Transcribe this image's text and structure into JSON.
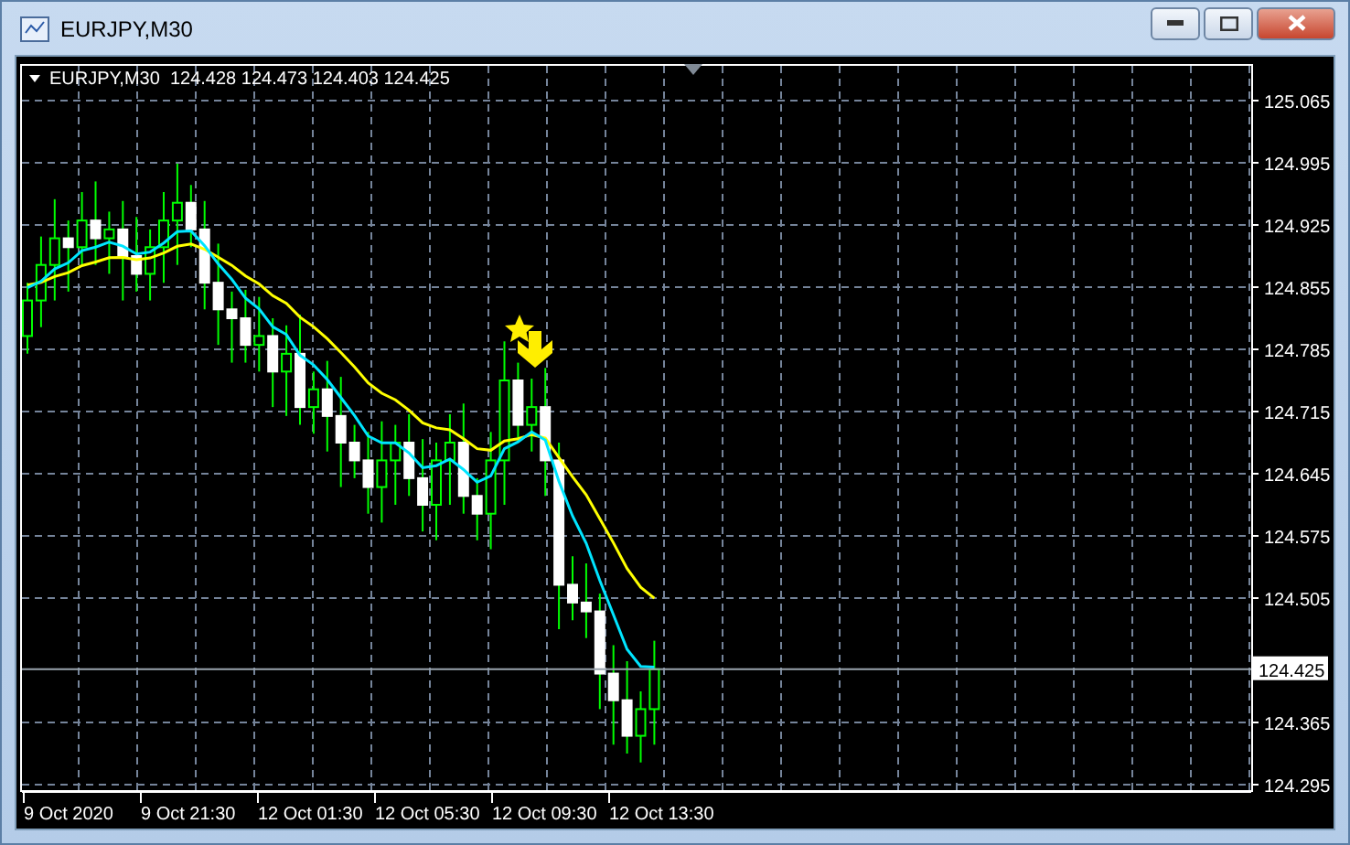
{
  "window": {
    "title": "EURJPY,M30"
  },
  "chart": {
    "symbol": "EURJPY,M30",
    "ohlc": [
      "124.428",
      "124.473",
      "124.403",
      "124.425"
    ],
    "price_ticks": [
      "125.065",
      "124.995",
      "124.925",
      "124.855",
      "124.785",
      "124.715",
      "124.645",
      "124.575",
      "124.505",
      "124.365",
      "124.295"
    ],
    "current_price": "124.425",
    "time_ticks": [
      "9 Oct 2020",
      "9 Oct 21:30",
      "12 Oct 01:30",
      "12 Oct 05:30",
      "12 Oct 09:30",
      "12 Oct 13:30"
    ]
  }
}
